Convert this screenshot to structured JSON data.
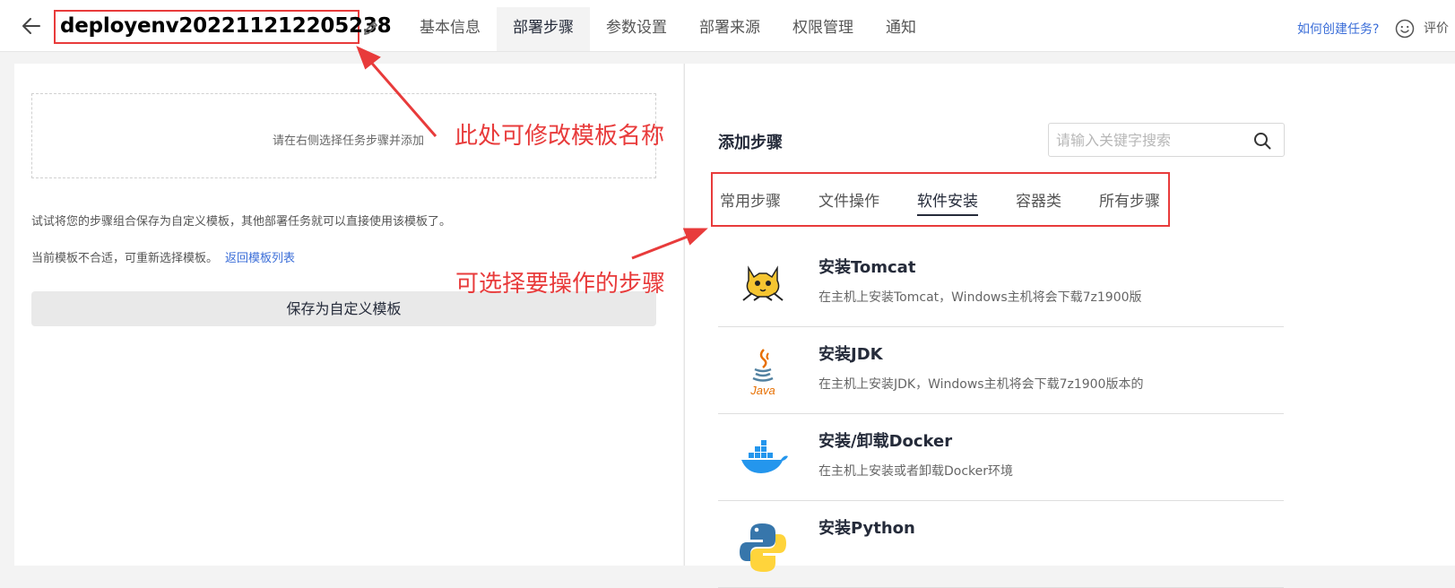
{
  "header": {
    "template_name": "deployenv20221121​2205238",
    "tabs": [
      "基本信息",
      "部署步骤",
      "参数设置",
      "部署来源",
      "权限管理",
      "通知"
    ],
    "active_tab": "部署步骤",
    "help_link": "如何创建任务?",
    "rate_label": "评价"
  },
  "left": {
    "drop_hint": "请在右侧选择任务步骤并添加",
    "tip_save": "试试将您的步骤组合保存为自定义模板，其他部署任务就可以直接使用该模板了。",
    "tip_reselect": "当前模板不合适，可重新选择模板。",
    "back_link": "返回模板列表",
    "save_button": "保存为自定义模板"
  },
  "right": {
    "title": "添加步骤",
    "search_placeholder": "请输入关键字搜索",
    "categories": [
      "常用步骤",
      "文件操作",
      "软件安装",
      "容器类",
      "所有步骤"
    ],
    "active_category": "软件安装",
    "steps": [
      {
        "name": "安装Tomcat",
        "desc": "在主机上安装Tomcat，Windows主机将会下载7z1900版",
        "icon": "tomcat-icon"
      },
      {
        "name": "安装JDK",
        "desc": "在主机上安装JDK，Windows主机将会下载7z1900版本的",
        "icon": "java-icon"
      },
      {
        "name": "安装/卸载Docker",
        "desc": "在主机上安装或者卸载Docker环境",
        "icon": "docker-icon"
      },
      {
        "name": "安装Python",
        "desc": "",
        "icon": "python-icon"
      }
    ]
  },
  "annotations": {
    "rename_note": "此处可修改模板名称",
    "select_note": "可选择要操作的步骤"
  },
  "colors": {
    "annotation": "#e83b3b",
    "link": "#3b6ed8",
    "active_tab_bg": "#f3f3f3"
  }
}
